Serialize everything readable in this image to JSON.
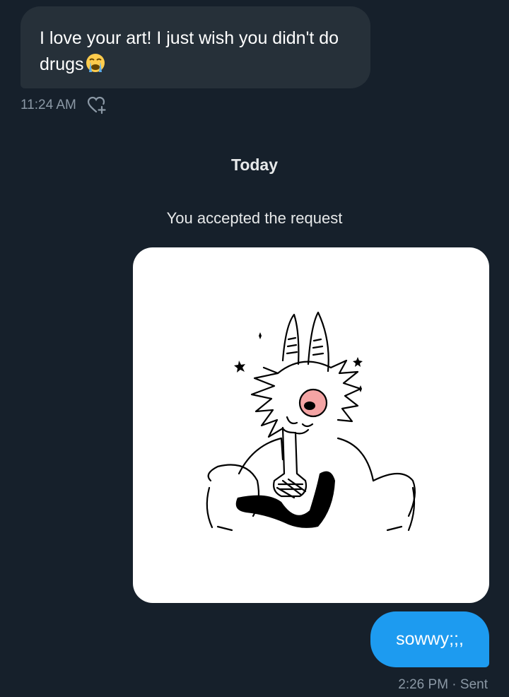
{
  "incoming_message": {
    "text": "I love your art! I just wish you didn't do drugs",
    "emoji": "loudly-crying-face",
    "timestamp": "11:24 AM",
    "react_icon": "heart-plus-icon"
  },
  "day_divider": "Today",
  "system_message": "You accepted the request",
  "media_message": {
    "kind": "image",
    "description_icon": "sketch-drawing"
  },
  "outgoing_message": {
    "text": "sowwy;;,",
    "status": "2:26 PM · Sent"
  },
  "colors": {
    "background": "#16202b",
    "incoming_bubble": "#263039",
    "outgoing_bubble": "#1d9bf0",
    "muted_text": "#8b98a5"
  }
}
